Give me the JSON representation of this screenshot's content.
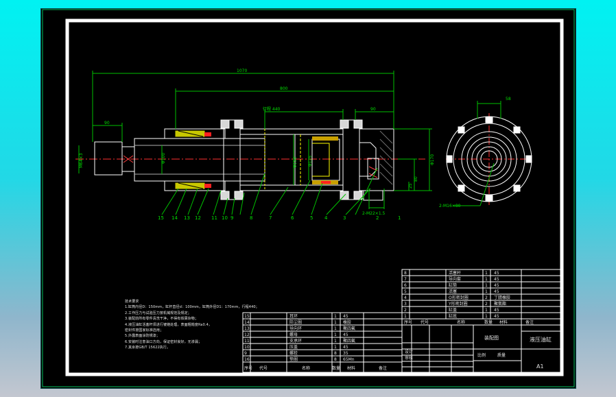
{
  "drawing": {
    "dimensions": {
      "overall_length": "1070",
      "body_length": "800",
      "stroke": "行程 440",
      "rod_end_offset": "90",
      "cap_offset": "90",
      "port_pitch": "58",
      "rod_thread": "M64×3",
      "rod_dia": "Φ100",
      "bore": "Φ150",
      "piston_dia": "Φ125",
      "tube_od": "Φ170",
      "right_height": "Φ70",
      "small_h": "25",
      "mid_h": "80",
      "port_label": "2-M22×1.5",
      "port_label2": "2-M22×1.5",
      "bolt_label": "2-M16×80"
    },
    "balloons": [
      "15",
      "14",
      "13",
      "12",
      "11",
      "10",
      "9",
      "8",
      "7",
      "6",
      "5",
      "4",
      "3",
      "2",
      "1"
    ],
    "notes": {
      "heading": "技术要求",
      "lines": [
        "1.缸筒内径D：150mm，缸杆直径d：100mm，缸筒外径D1：170mm，行程440；",
        "2.工作压力与试验压力按机械规范及规定；",
        "3.装配前所有零件清洗干净，不得有铁屑杂物；",
        "4.液压油缸活塞杆须进行镀铬处理，表面粗糙度Ra0.4，",
        "密封件按国家标准选用；",
        "5.外露表面涂防锈漆；",
        "6.安装时注意油口方向，保证密封良好，无渗漏；",
        "7.其余按GB/T 15622执行。"
      ]
    },
    "parts_upper": [
      {
        "no": "8",
        "name": "活塞杆",
        "qty": "1",
        "mat": "45"
      },
      {
        "no": "7",
        "name": "导向套",
        "qty": "1",
        "mat": "45"
      },
      {
        "no": "6",
        "name": "缸筒",
        "qty": "1",
        "mat": "45"
      },
      {
        "no": "5",
        "name": "活塞",
        "qty": "1",
        "mat": "45"
      },
      {
        "no": "4",
        "name": "O形密封圈",
        "qty": "2",
        "mat": "丁腈橡胶"
      },
      {
        "no": "3",
        "name": "Y形密封圈",
        "qty": "2",
        "mat": "聚氨酯"
      },
      {
        "no": "2",
        "name": "缸盖",
        "qty": "1",
        "mat": "45"
      },
      {
        "no": "1",
        "name": "缸底",
        "qty": "1",
        "mat": "45"
      }
    ],
    "parts_lower": [
      {
        "no": "15",
        "name": "耳环",
        "qty": "1",
        "mat": "45"
      },
      {
        "no": "14",
        "name": "防尘圈",
        "qty": "1",
        "mat": "橡胶"
      },
      {
        "no": "13",
        "name": "导向环",
        "qty": "1",
        "mat": "聚四氟"
      },
      {
        "no": "12",
        "name": "螺母",
        "qty": "1",
        "mat": "45"
      },
      {
        "no": "11",
        "name": "支承环",
        "qty": "1",
        "mat": "聚四氟"
      },
      {
        "no": "10",
        "name": "压盖",
        "qty": "1",
        "mat": "45"
      },
      {
        "no": "9",
        "name": "螺栓",
        "qty": "8",
        "mat": "35"
      },
      {
        "no": "16",
        "name": "垫圈",
        "qty": "8",
        "mat": "65Mn"
      }
    ],
    "header_lower": [
      "序号",
      "代号",
      "名称",
      "数量",
      "材料",
      "备注"
    ],
    "header_upper": [
      "序号",
      "代号",
      "名称",
      "数量",
      "材料",
      "备注"
    ],
    "title_block": {
      "title": "液压油缸",
      "sheet_size": "A1",
      "scale_label": "比例",
      "drawn_by": "设计",
      "checked_by": "审核",
      "mass_label": "质量",
      "school": "装配图"
    }
  }
}
